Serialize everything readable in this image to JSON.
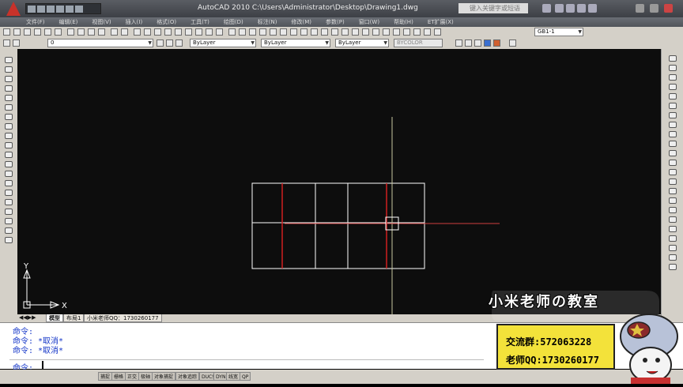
{
  "window": {
    "title": "AutoCAD 2010    C:\\Users\\Administrator\\Desktop\\Drawing1.dwg",
    "search_placeholder": "键入关键字或短语"
  },
  "menu": [
    "文件(F)",
    "编辑(E)",
    "视图(V)",
    "插入(I)",
    "格式(O)",
    "工具(T)",
    "绘图(D)",
    "标注(N)",
    "修改(M)",
    "参数(P)",
    "窗口(W)",
    "帮助(H)",
    "ET扩展(X)"
  ],
  "toolbar": {
    "dimstyle": "GB1-1",
    "layer": "0",
    "color": "ByLayer",
    "linetype": "ByLayer",
    "lineweight": "ByLayer",
    "plotstyle": "BYCOLOR"
  },
  "ucs": {
    "y_label": "Y",
    "x_label": "X"
  },
  "tabs": [
    "模型",
    "布局1",
    "小米老师QQ：1730260177"
  ],
  "command_history": [
    "命令:",
    "命令: *取消*",
    "命令: *取消*"
  ],
  "command_prompt": "命令:",
  "status_buttons": [
    "捕捉",
    "栅格",
    "正交",
    "极轴",
    "对象捕捉",
    "对象追踪",
    "DUCS",
    "DYN",
    "线宽",
    "QP"
  ],
  "watermark": {
    "title": "小米老师の教室",
    "group": "交流群:572063228",
    "qq": "老师QQ:1730260177"
  },
  "colors": {
    "canvas_bg": "#0d0d0d",
    "entity": "#ffffff",
    "red_line": "#d02020",
    "crosshair_v": "#c8c8a0",
    "crosshair_h": "#d04040",
    "command_text": "#1436c8",
    "info_bg": "#f3e23a"
  }
}
